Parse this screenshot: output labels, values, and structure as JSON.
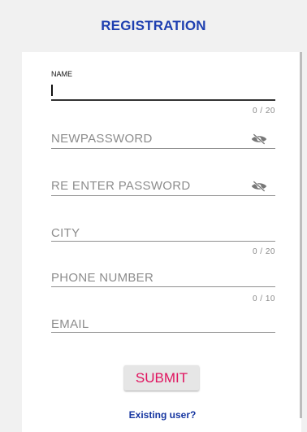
{
  "header": {
    "title": "REGISTRATION"
  },
  "form": {
    "name": {
      "label": "NAME",
      "counter": "0 / 20"
    },
    "new_password": {
      "placeholder": "NEWPASSWORD"
    },
    "reenter_password": {
      "placeholder": "RE ENTER PASSWORD"
    },
    "city": {
      "placeholder": "CITY",
      "counter": "0 / 20"
    },
    "phone": {
      "placeholder": "PHONE NUMBER",
      "counter": "0 / 10"
    },
    "email": {
      "placeholder": "EMAIL"
    }
  },
  "submit_label": "SUBMIT",
  "existing_user_label": "Existing user?",
  "colors": {
    "title": "#1e3fb0",
    "submit_text": "#e0125e",
    "link": "#1535a0",
    "background": "#f1f1f1"
  },
  "icons": {
    "password_toggle": "eye-off-icon"
  }
}
